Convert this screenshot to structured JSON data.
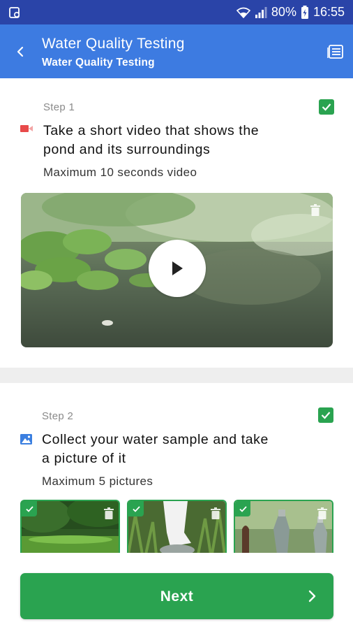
{
  "status_bar": {
    "battery": "80%",
    "time": "16:55"
  },
  "app_bar": {
    "title": "Water Quality Testing",
    "subtitle": "Water Quality Testing"
  },
  "steps": [
    {
      "label": "Step 1",
      "title_line1": "Take a short video that shows the",
      "title_line2": "pond and its surroundings",
      "description": "Maximum 10 seconds video",
      "media_type": "video",
      "completed": true
    },
    {
      "label": "Step 2",
      "title_line1": "Collect your water sample and take",
      "title_line2": "a picture of it",
      "description": "Maximum 5 pictures",
      "media_type": "pictures",
      "completed": true
    }
  ],
  "next_button": {
    "label": "Next"
  },
  "colors": {
    "status_bar": "#2a44a8",
    "app_bar": "#3d7be1",
    "accent_green": "#2aa350"
  },
  "icons": {
    "back": "arrow-left-icon",
    "list": "list-view-icon",
    "video_type": "video-camera-icon",
    "image_type": "image-icon",
    "play": "play-icon",
    "delete": "trash-icon",
    "check": "check-icon",
    "next": "chevron-right-icon"
  }
}
